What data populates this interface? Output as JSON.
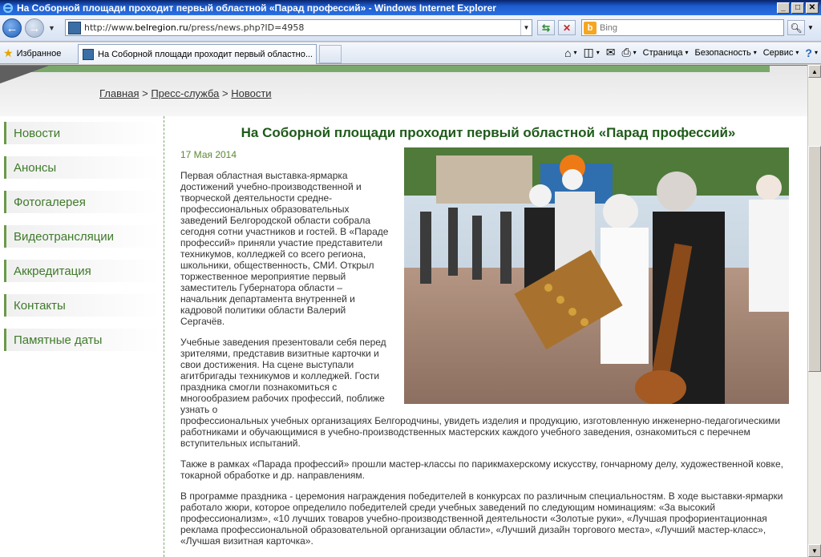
{
  "window": {
    "title": "На Соборной площади проходит первый областной «Парад профессий» - Windows Internet Explorer",
    "buttons": {
      "minimize": "_",
      "maximize": "□",
      "close": "✕"
    }
  },
  "address_bar": {
    "url_prefix": "http://www.",
    "url_domain": "belregion.ru",
    "url_path": "/press/news.php?ID=4958"
  },
  "search": {
    "placeholder": "Bing",
    "logo_letter": "b"
  },
  "favorites": {
    "label": "Избранное"
  },
  "tab": {
    "label": "На Соборной площади проходит первый областно..."
  },
  "command_bar": {
    "page": "Страница",
    "safety": "Безопасность",
    "tools": "Сервис",
    "help": "?"
  },
  "breadcrumb": {
    "items": [
      "Главная",
      "Пресс-служба",
      "Новости"
    ],
    "separator": " > "
  },
  "sidebar": {
    "items": [
      {
        "label": "Новости"
      },
      {
        "label": "Анонсы"
      },
      {
        "label": "Фотогалерея"
      },
      {
        "label": "Видеотрансляции"
      },
      {
        "label": "Аккредитация"
      },
      {
        "label": "Контакты"
      },
      {
        "label": "Памятные даты"
      }
    ]
  },
  "article": {
    "title": "На Соборной площади проходит первый областной «Парад профессий»",
    "date": "17 Мая 2014",
    "p1": "Первая областная выставка-ярмарка достижений учебно-производственной и творческой деятельности средне-профессиональных образовательных заведений Белгородской области собрала сегодня сотни участников и гостей. В «Параде профессий» приняли участие представители техникумов, колледжей со всего региона, школьники, общественность, СМИ. Открыл торжественное мероприятие первый заместитель Губернатора области – начальник департамента внутренней и кадровой политики области Валерий Сергачёв.",
    "p2_wrap": "Учебные заведения презентовали себя перед зрителями, представив визитные карточки и свои достижения. На сцене выступали агитбригады техникумов и колледжей. Гости праздника смогли познакомиться с многообразием рабочих профессий, поближе узнать о",
    "p2_rest": "профессиональных учебных организациях Белгородчины, увидеть изделия и продукцию, изготовленную инженерно-педагогическими работниками и обучающимися в учебно-производственных мастерских каждого учебного заведения, ознакомиться с перечнем вступительных испытаний.",
    "p3": "Также в рамках «Парада профессий» прошли мастер-классы по парикмахерскому искусству, гончарному делу, художественной ковке, токарной обработке и др. направлениям.",
    "p4": "В программе праздника - церемония награждения победителей в конкурсах по различным специальностям. В ходе выставки-ярмарки работало жюри, которое определило победителей среди учебных заведений по следующим номинациям: «За высокий профессионализм», «10 лучших товаров учебно-производственной деятельности «Золотые руки», «Лучшая профориентационная реклама профессиональной образовательной организации области», «Лучший дизайн торгового места», «Лучший мастер-класс», «Лучшая визитная карточка»."
  },
  "colors": {
    "accent_green": "#3f7a2a",
    "title_green": "#1f5a1a",
    "titlebar_blue": "#1c5ccf"
  }
}
